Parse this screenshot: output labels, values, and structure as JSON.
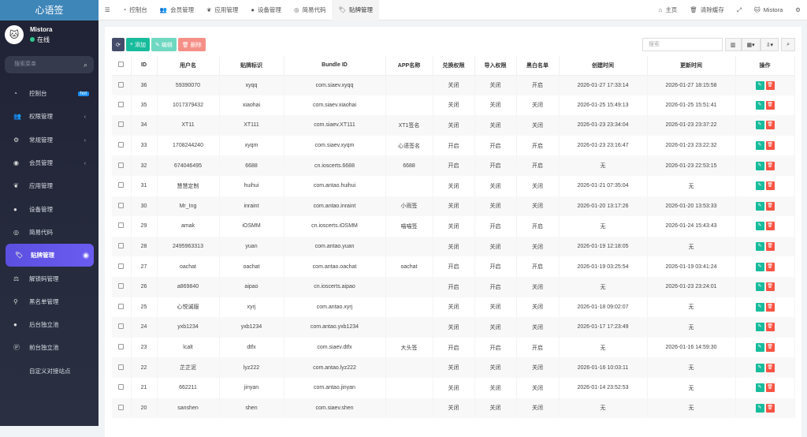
{
  "app": {
    "title": "心语签"
  },
  "user": {
    "name": "Mistora",
    "status": "在线"
  },
  "sidebar": {
    "search_placeholder": "搜索菜单",
    "items": [
      {
        "label": "控制台",
        "icon": "dashboard-icon",
        "badge": "hot"
      },
      {
        "label": "权限管理",
        "icon": "users-icon",
        "arrow": true
      },
      {
        "label": "常规管理",
        "icon": "cogs-icon",
        "arrow": true
      },
      {
        "label": "会员管理",
        "icon": "user-circle-icon",
        "arrow": true
      },
      {
        "label": "应用管理",
        "icon": "leaf-icon"
      },
      {
        "label": "设备管理",
        "icon": "device-icon"
      },
      {
        "label": "简易代码",
        "icon": "eye-icon"
      },
      {
        "label": "贴牌管理",
        "icon": "tags-icon",
        "active": true
      },
      {
        "label": "解锁码管理",
        "icon": "balance-icon"
      },
      {
        "label": "黑名单管理",
        "icon": "bicycle-icon"
      },
      {
        "label": "后台独立池",
        "icon": "apple-icon"
      },
      {
        "label": "前台独立池",
        "icon": "p-icon"
      },
      {
        "label": "自定义对接站点",
        "icon": "code-icon"
      }
    ]
  },
  "tabs": [
    {
      "label": "控制台"
    },
    {
      "label": "会员管理"
    },
    {
      "label": "应用管理"
    },
    {
      "label": "设备管理"
    },
    {
      "label": "简易代码"
    },
    {
      "label": "贴牌管理"
    }
  ],
  "topright": {
    "home": "主页",
    "clear_cache": "清除缓存",
    "user": "Mistora"
  },
  "toolbar": {
    "add": "添加",
    "edit": "编辑",
    "delete": "删除",
    "search_placeholder": "搜索"
  },
  "columns": [
    "ID",
    "用户名",
    "贴牌标识",
    "Bundle ID",
    "APP名称",
    "兑换权限",
    "导入权限",
    "黑白名单",
    "创建时间",
    "更新时间",
    "操作"
  ],
  "rows": [
    [
      "36",
      "59390070",
      "xyqq",
      "com.siaev.xyqq",
      "",
      "关闭",
      "关闭",
      "开启",
      "2026-01-27 17:33:14",
      "2026-01-27 18:15:58"
    ],
    [
      "35",
      "1017379432",
      "xiaohai",
      "com.siaev.xiaohai",
      "",
      "关闭",
      "关闭",
      "关闭",
      "2026-01-25 15:49:13",
      "2026-01-25 15:51:41"
    ],
    [
      "34",
      "XT11",
      "XT111",
      "com.siaev.XT111",
      "XT1签名",
      "关闭",
      "关闭",
      "关闭",
      "2026-01-23 23:34:04",
      "2026-01-23 23:37:22"
    ],
    [
      "33",
      "1708244240",
      "xyqm",
      "com.siaev.xyqm",
      "心语签名",
      "开启",
      "开启",
      "开启",
      "2026-01-23 23:16:47",
      "2026-01-23 23:22:32"
    ],
    [
      "32",
      "674046495",
      "6688",
      "cn.ioscerts.6688",
      "6688",
      "开启",
      "开启",
      "开启",
      "无",
      "2026-01-23 22:53:15"
    ],
    [
      "31",
      "慧慧定制",
      "huihui",
      "com.antao.huihui",
      "",
      "关闭",
      "关闭",
      "关闭",
      "2026-01-21 07:35:04",
      "无"
    ],
    [
      "30",
      "Mr_Ing",
      "inraint",
      "com.antao.inraint",
      "小雨签",
      "关闭",
      "关闭",
      "关闭",
      "2026-01-20 13:17:26",
      "2026-01-20 13:53:33"
    ],
    [
      "29",
      "amak",
      "iOSMM",
      "cn.ioscerts.iOSMM",
      "喵喵签",
      "关闭",
      "开启",
      "开启",
      "无",
      "2026-01-24 15:43:43"
    ],
    [
      "28",
      "2495963313",
      "yuan",
      "com.antao.yuan",
      "",
      "关闭",
      "关闭",
      "关闭",
      "2026-01-19 12:18:05",
      "无"
    ],
    [
      "27",
      "oachat",
      "oachat",
      "com.antao.oachat",
      "oachat",
      "开启",
      "开启",
      "开启",
      "2026-01-19 03:25:54",
      "2026-01-19 03:41:24"
    ],
    [
      "26",
      "a869840",
      "aipao",
      "cn.ioscerts.aipao",
      "",
      "开启",
      "开启",
      "关闭",
      "无",
      "2026-01-23 23:24:01"
    ],
    [
      "25",
      "心悦诚服",
      "xyrj",
      "com.antao.xyrj",
      "",
      "关闭",
      "关闭",
      "关闭",
      "2026-01-18 09:02:07",
      "无"
    ],
    [
      "24",
      "yxb1234",
      "yxb1234",
      "com.antao.yxb1234",
      "",
      "关闭",
      "关闭",
      "关闭",
      "2026-01-17 17:23:49",
      "无"
    ],
    [
      "23",
      "lcalt",
      "dtfx",
      "com.siaev.dtfx",
      "大头签",
      "开启",
      "开启",
      "开启",
      "无",
      "2026-01-16 14:59:30"
    ],
    [
      "22",
      "芷芷泥",
      "lyz222",
      "com.antao.lyz222",
      "",
      "关闭",
      "关闭",
      "关闭",
      "2026-01-16 10:03:11",
      "无"
    ],
    [
      "21",
      "662211",
      "jinyan",
      "com.antao.jinyan",
      "",
      "关闭",
      "关闭",
      "关闭",
      "2026-01-14 23:52:53",
      "无"
    ],
    [
      "20",
      "sanshen",
      "shen",
      "com.siaev.shen",
      "",
      "关闭",
      "关闭",
      "关闭",
      "无",
      "无"
    ]
  ]
}
